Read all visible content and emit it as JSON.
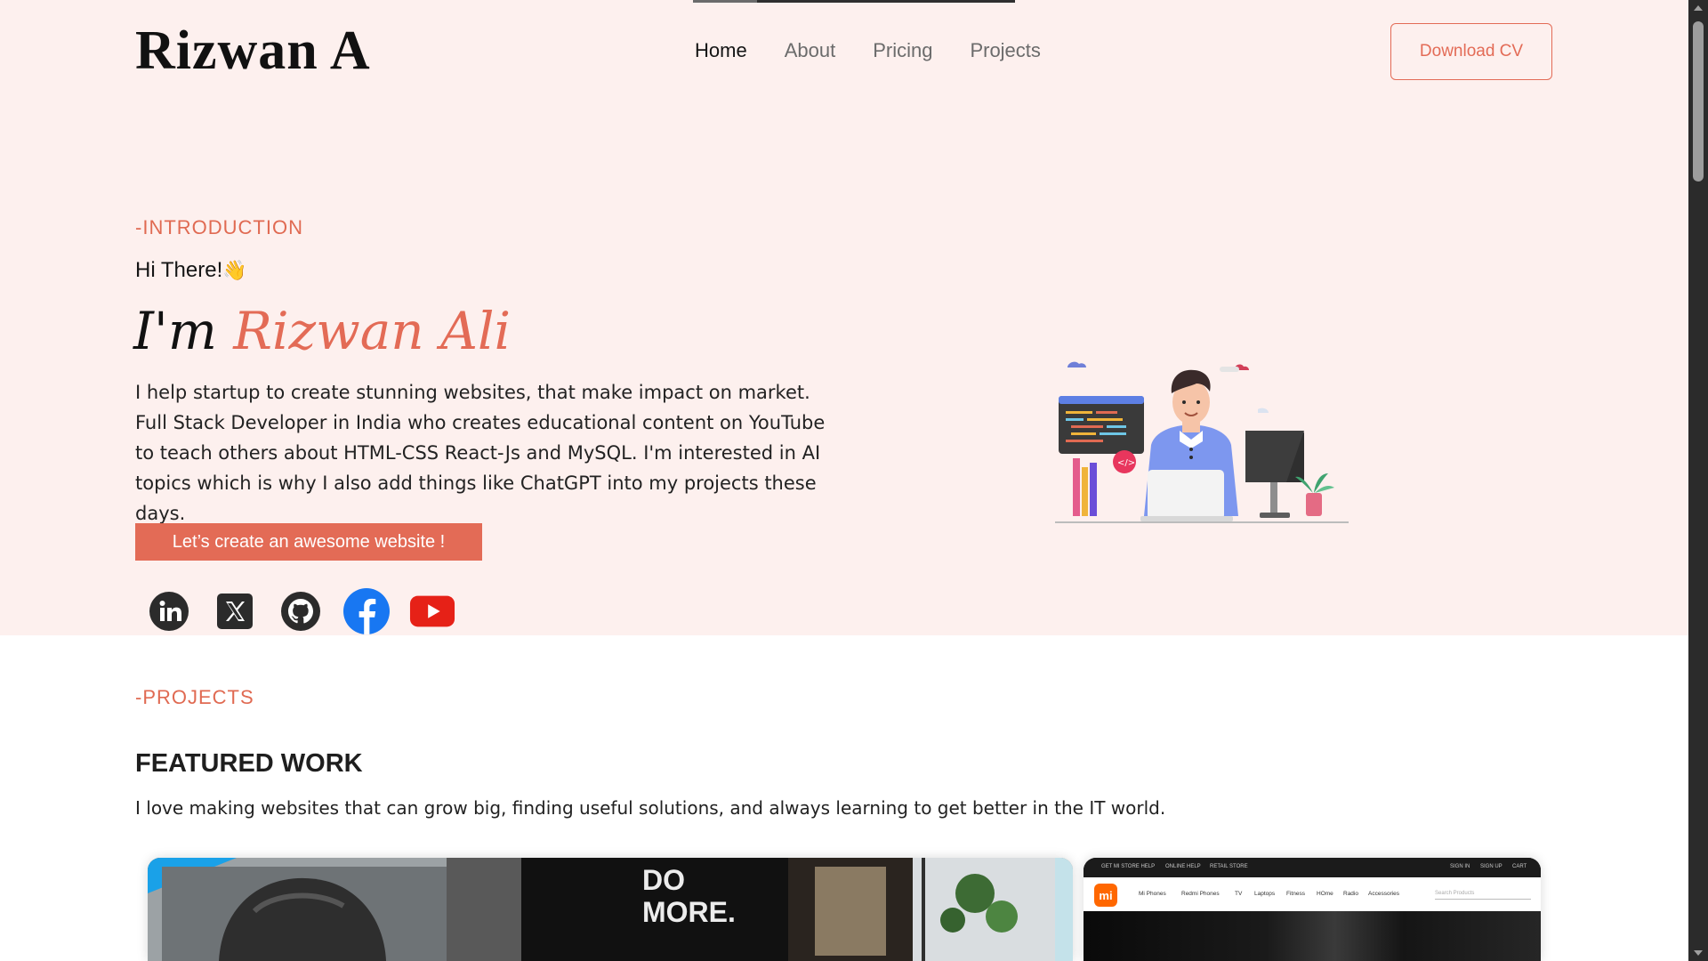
{
  "header": {
    "logo": "Rizwan A",
    "nav": [
      {
        "label": "Home",
        "active": true
      },
      {
        "label": "About",
        "active": false
      },
      {
        "label": "Pricing",
        "active": false
      },
      {
        "label": "Projects",
        "active": false
      }
    ],
    "cv_button": "Download CV"
  },
  "hero": {
    "tag": "-INTRODUCTION",
    "greeting": "Hi There!",
    "greeting_emoji": "👋",
    "im": "I'm",
    "name": "Rizwan Ali",
    "description": "I help startup to create stunning websites, that make impact on market. Full Stack Developer in India who creates educational content on YouTube to teach others about HTML-CSS React-Js and MySQL. I'm interested in AI topics which is why I also add things like ChatGPT into my projects these days.",
    "cta": "Let’s create an awesome website !",
    "socials": [
      "linkedin-icon",
      "x-icon",
      "github-icon",
      "facebook-icon",
      "youtube-icon"
    ]
  },
  "projects": {
    "tag": "-PROJECTS",
    "title": "FEATURED WORK",
    "description": "I love making websites that can grow big, finding useful solutions, and always learning to get better in the IT world.",
    "card1": {
      "poster_text_1": "DO",
      "poster_text_2": "MORE."
    },
    "card2": {
      "logo": "mi",
      "top_links": [
        "GET MI STORE HELP",
        "ONLINE HELP",
        "RETAIL STORE"
      ],
      "top_right": [
        "SIGN IN",
        "SIGN UP",
        "CART"
      ],
      "nav_items": [
        "Mi Phones",
        "Redmi Phones",
        "TV",
        "Laptops",
        "Fitness",
        "HOme",
        "Radio",
        "Accessories"
      ],
      "search_placeholder": "Search Products"
    }
  },
  "colors": {
    "accent": "#e36b56",
    "hero_bg": "#fdf0ee"
  }
}
